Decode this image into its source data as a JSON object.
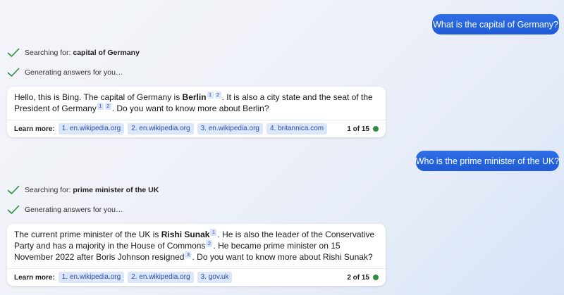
{
  "conversation": {
    "q1": {
      "text": "What is the capital of Germany?"
    },
    "q1_status": {
      "searching_prefix": "Searching for:",
      "searching_term": "capital of Germany",
      "generating": "Generating answers for you…"
    },
    "a1": {
      "part1": "Hello, this is Bing. The capital of Germany is ",
      "bold": "Berlin",
      "cite_a": "1",
      "cite_b": "2",
      "part2": ". It is also a city state and the seat of the President of Germany",
      "cite_c": "1",
      "cite_d": "2",
      "part3": ". Do you want to know more about Berlin?",
      "learn_more_label": "Learn more:",
      "links": [
        "1. en.wikipedia.org",
        "2. en.wikipedia.org",
        "3. en.wikipedia.org",
        "4. britannica.com"
      ],
      "counter": "1 of 15",
      "status_color": "#2e8b3f"
    },
    "q2": {
      "text": "Who is the prime minister of the UK?"
    },
    "q2_status": {
      "searching_prefix": "Searching for:",
      "searching_term": "prime minister of the UK",
      "generating": "Generating answers for you…"
    },
    "a2": {
      "part1": "The current prime minister of the UK is ",
      "bold": "Rishi Sunak",
      "cite_a": "1",
      "part2": ". He is also the leader of the Conservative Party and has a majority in the House of Commons",
      "cite_b": "2",
      "part3": ". He became prime minister on 15 November 2022 after Boris Johnson resigned",
      "cite_c": "3",
      "part4": ". Do you want to know more about Rishi Sunak?",
      "learn_more_label": "Learn more:",
      "links": [
        "1. en.wikipedia.org",
        "2. en.wikipedia.org",
        "3. gov.uk"
      ],
      "counter": "2 of 15",
      "status_color": "#2e8b3f"
    }
  },
  "colors": {
    "user_bubble": "#1f5bd6",
    "check": "#2e8b3f",
    "chip_bg": "#dce6fa",
    "chip_text": "#2a4f9e"
  },
  "icons": {
    "check": "checkmark-icon",
    "status": "status-dot-icon"
  }
}
